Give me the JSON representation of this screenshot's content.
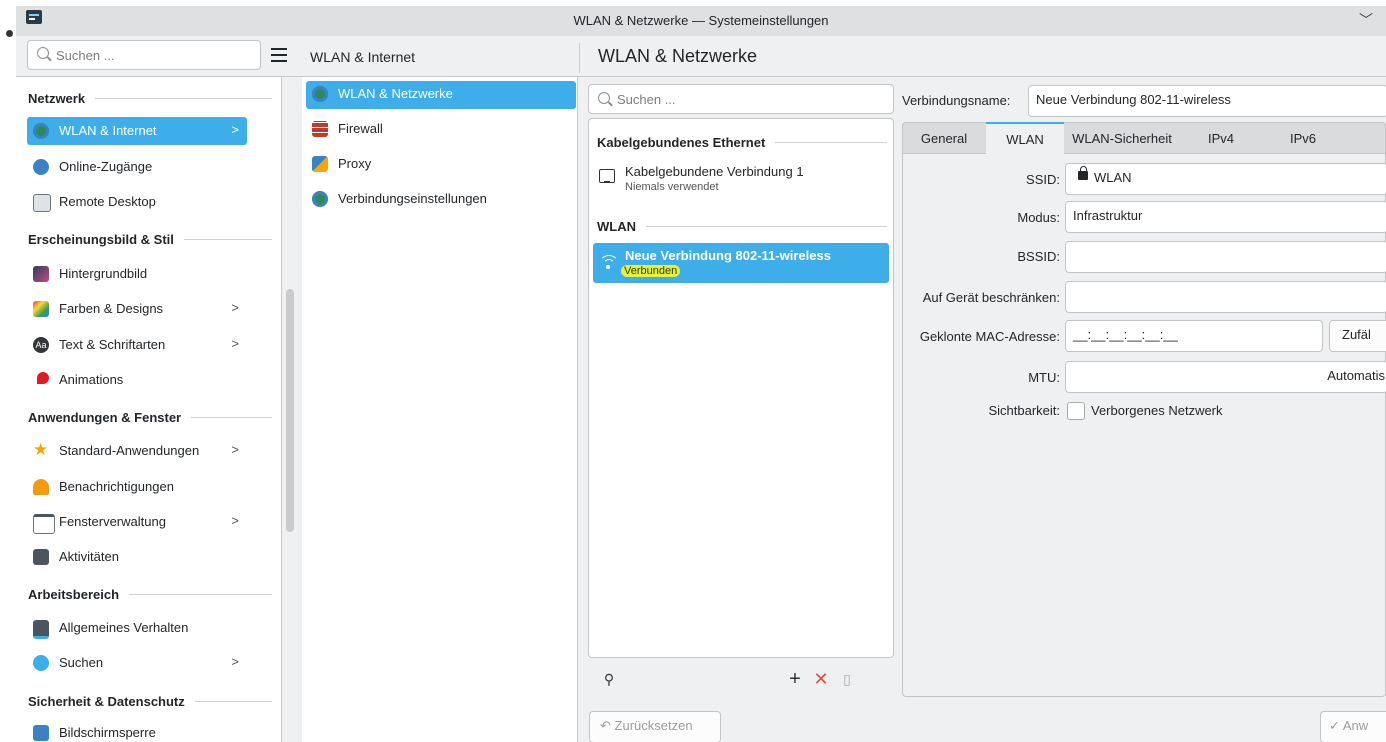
{
  "window": {
    "title": "WLAN & Netzwerke — Systemeinstellungen"
  },
  "sidebar": {
    "search_placeholder": "Suchen ...",
    "sections": [
      {
        "header": "Netzwerk",
        "items": [
          {
            "label": "WLAN & Internet",
            "active": true,
            "chevron": true,
            "icon": "globe-icon"
          },
          {
            "label": "Online-Zugänge",
            "chevron": false,
            "icon": "online-accounts-icon"
          },
          {
            "label": "Remote Desktop",
            "chevron": false,
            "icon": "remote-desktop-icon"
          }
        ]
      },
      {
        "header": "Erscheinungsbild & Stil",
        "items": [
          {
            "label": "Hintergrundbild",
            "chevron": false,
            "icon": "wallpaper-icon"
          },
          {
            "label": "Farben & Designs",
            "chevron": true,
            "icon": "colors-icon"
          },
          {
            "label": "Text & Schriftarten",
            "chevron": true,
            "icon": "fonts-icon"
          },
          {
            "label": "Animations",
            "chevron": false,
            "icon": "animations-icon"
          }
        ]
      },
      {
        "header": "Anwendungen & Fenster",
        "items": [
          {
            "label": "Standard-Anwendungen",
            "chevron": true,
            "icon": "star-icon"
          },
          {
            "label": "Benachrichtigungen",
            "chevron": false,
            "icon": "bell-icon"
          },
          {
            "label": "Fensterverwaltung",
            "chevron": true,
            "icon": "window-icon"
          },
          {
            "label": "Aktivitäten",
            "chevron": false,
            "icon": "activities-icon"
          }
        ]
      },
      {
        "header": "Arbeitsbereich",
        "items": [
          {
            "label": "Allgemeines Verhalten",
            "chevron": false,
            "icon": "general-behavior-icon"
          },
          {
            "label": "Suchen",
            "chevron": true,
            "icon": "search-icon"
          }
        ]
      },
      {
        "header": "Sicherheit & Datenschutz",
        "items": [
          {
            "label": "Bildschirmsperre",
            "chevron": false,
            "icon": "lock-screen-icon"
          }
        ]
      }
    ]
  },
  "column2": {
    "header": "WLAN & Internet",
    "items": [
      {
        "label": "WLAN & Netzwerke",
        "active": true,
        "icon": "globe-icon"
      },
      {
        "label": "Firewall",
        "icon": "firewall-icon"
      },
      {
        "label": "Proxy",
        "icon": "proxy-icon"
      },
      {
        "label": "Verbindungseinstellungen",
        "icon": "globe-icon"
      }
    ]
  },
  "main": {
    "title": "WLAN & Netzwerke",
    "search_placeholder": "Suchen ...",
    "sections": {
      "ethernet_header": "Kabelgebundenes Ethernet",
      "wlan_header": "WLAN"
    },
    "connections": [
      {
        "name": "Kabelgebundene Verbindung 1",
        "status": "Niemals verwendet",
        "type": "ethernet"
      },
      {
        "name": "Neue Verbindung 802-11-wireless",
        "status": "Verbunden",
        "type": "wifi",
        "active": true
      }
    ],
    "toolbar": {
      "plus": "+",
      "remove": "✕"
    }
  },
  "details": {
    "connection_name_label": "Verbindungsname:",
    "connection_name_value": "Neue Verbindung 802-11-wireless",
    "tabs": [
      "General",
      "WLAN",
      "WLAN-Sicherheit",
      "IPv4",
      "IPv6"
    ],
    "active_tab": "WLAN",
    "fields": {
      "ssid_label": "SSID:",
      "ssid_value": "WLAN",
      "mode_label": "Modus:",
      "mode_value": "Infrastruktur",
      "bssid_label": "BSSID:",
      "bssid_value": "",
      "restrict_label": "Auf Gerät beschränken:",
      "restrict_value": "",
      "mac_label": "Geklonte MAC-Adresse:",
      "mac_value": "__:__:__:__:__:__",
      "random_button": "Zufäl",
      "mtu_label": "MTU:",
      "mtu_value": "Automatis",
      "visibility_label": "Sichtbarkeit:",
      "hidden_network_label": "Verborgenes Netzwerk"
    }
  },
  "footer": {
    "reset_label": "Zurücksetzen",
    "apply_label": "Anw"
  },
  "colors": {
    "accent": "#3daee9",
    "highlight": "#e6f23a"
  }
}
